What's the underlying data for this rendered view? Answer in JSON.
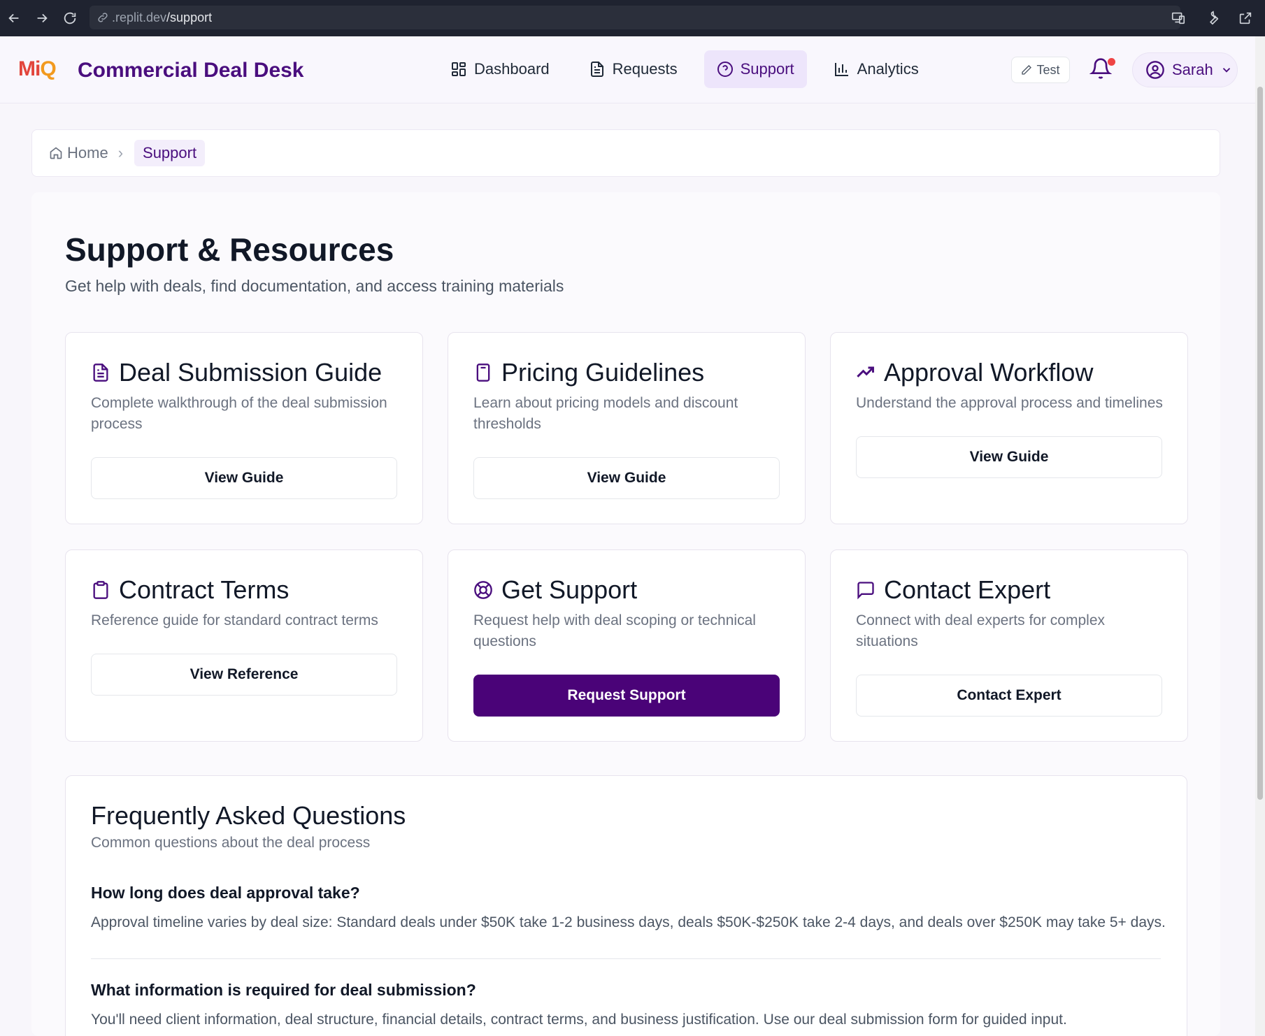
{
  "browser": {
    "url_host": ".replit.dev",
    "url_path": "/support"
  },
  "header": {
    "logo": {
      "m": "M",
      "i": "i",
      "q": "Q"
    },
    "title": "Commercial Deal Desk",
    "nav": [
      {
        "label": "Dashboard",
        "icon": "dashboard-icon"
      },
      {
        "label": "Requests",
        "icon": "document-icon"
      },
      {
        "label": "Support",
        "icon": "help-circle-icon",
        "active": true
      },
      {
        "label": "Analytics",
        "icon": "bar-chart-icon"
      }
    ],
    "test_label": "Test",
    "user_name": "Sarah"
  },
  "breadcrumb": {
    "home": "Home",
    "current": "Support"
  },
  "page": {
    "title": "Support & Resources",
    "subtitle": "Get help with deals, find documentation, and access training materials"
  },
  "cards": [
    {
      "title": "Deal Submission Guide",
      "description": "Complete walkthrough of the deal submission process",
      "button": "View Guide",
      "icon": "file-text-icon"
    },
    {
      "title": "Pricing Guidelines",
      "description": "Learn about pricing models and discount thresholds",
      "button": "View Guide",
      "icon": "calculator-icon"
    },
    {
      "title": "Approval Workflow",
      "description": "Understand the approval process and timelines",
      "button": "View Guide",
      "icon": "trending-up-icon"
    },
    {
      "title": "Contract Terms",
      "description": "Reference guide for standard contract terms",
      "button": "View Reference",
      "icon": "clipboard-icon"
    },
    {
      "title": "Get Support",
      "description": "Request help with deal scoping or technical questions",
      "button": "Request Support",
      "icon": "life-buoy-icon",
      "primary": true
    },
    {
      "title": "Contact Expert",
      "description": "Connect with deal experts for complex situations",
      "button": "Contact Expert",
      "icon": "message-square-icon"
    }
  ],
  "faq": {
    "title": "Frequently Asked Questions",
    "subtitle": "Common questions about the deal process",
    "items": [
      {
        "q": "How long does deal approval take?",
        "a": "Approval timeline varies by deal size: Standard deals under $50K take 1-2 business days, deals $50K-$250K take 2-4 days, and deals over $250K may take 5+ days."
      },
      {
        "q": "What information is required for deal submission?",
        "a": "You'll need client information, deal structure, financial details, contract terms, and business justification. Use our deal submission form for guided input."
      }
    ]
  },
  "colors": {
    "brand": "#4a0e7e",
    "primary_button": "#4a0378",
    "logo_red": "#e2453c",
    "logo_orange": "#f29a1f",
    "notification_dot": "#ef4444"
  }
}
